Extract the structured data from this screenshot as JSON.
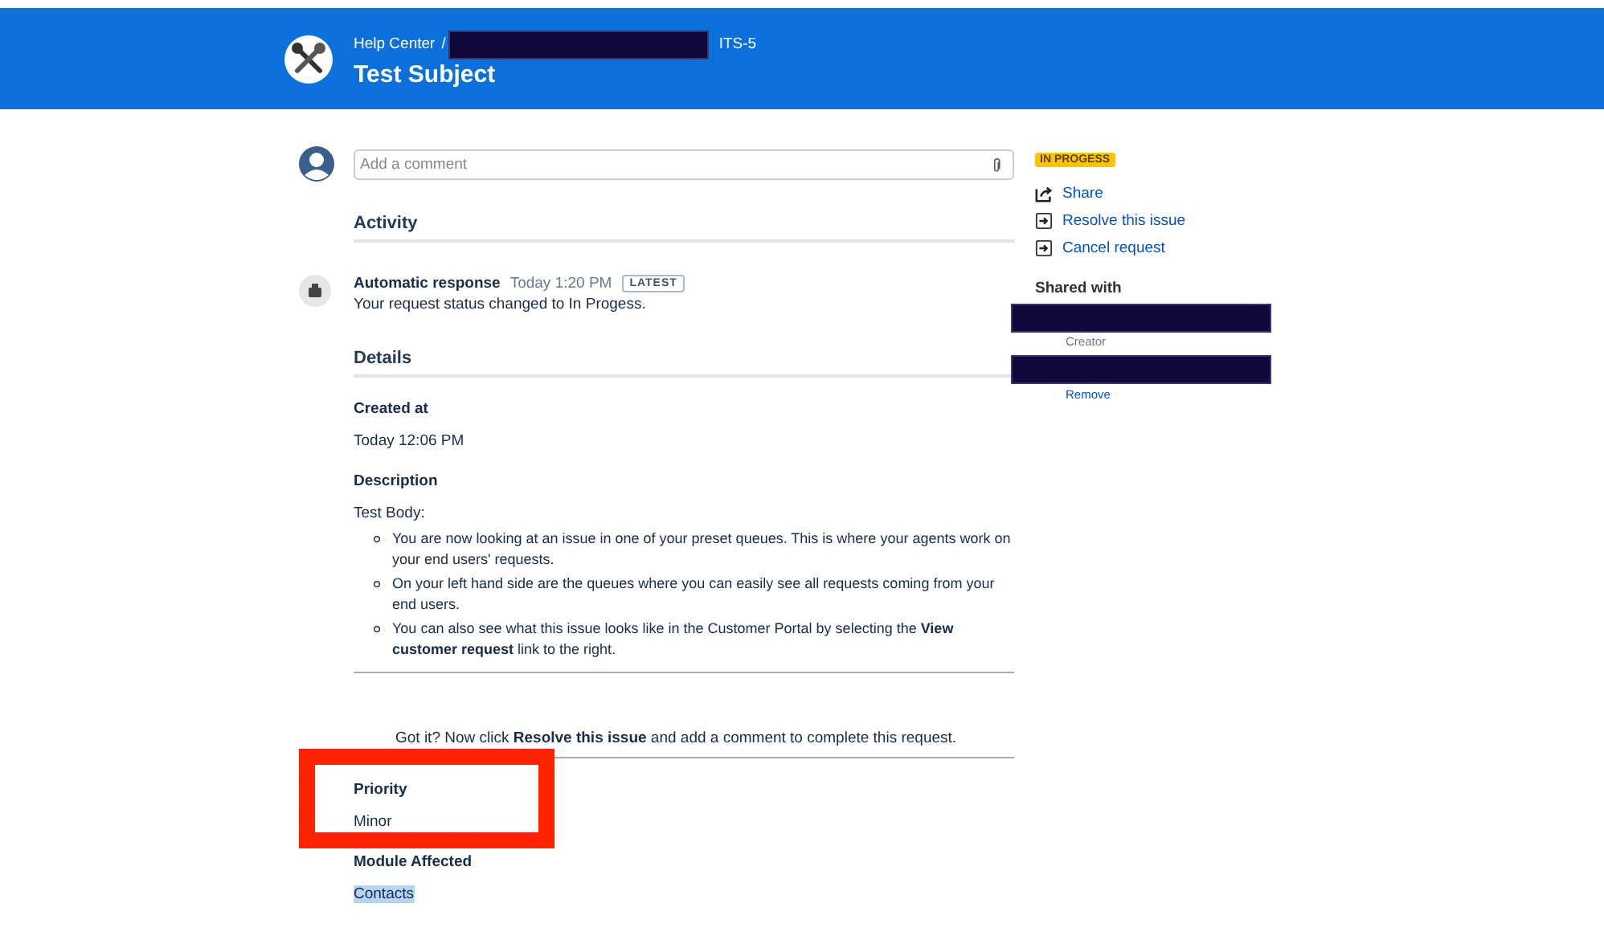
{
  "header": {
    "breadcrumb": "Help Center",
    "separator": "/",
    "redacted": true,
    "issue_key": "ITS-5",
    "title": "Test Subject"
  },
  "comment": {
    "placeholder": "Add a comment"
  },
  "activity": {
    "heading": "Activity",
    "entries": [
      {
        "author": "Automatic response",
        "time": "Today 1:20 PM",
        "badge": "LATEST",
        "message": "Your request status changed to In Progess."
      }
    ]
  },
  "details": {
    "heading": "Details",
    "fields": [
      {
        "kind": "text",
        "label": "Created at",
        "value": "Today 12:06 PM",
        "highlighted": false,
        "selected": false
      },
      {
        "kind": "description",
        "label": "Description",
        "intro": "Test Body:",
        "items": [
          "You are now looking at an issue in one of your preset queues. This is where your agents work on your end users' requests.",
          "On your left hand side are the queues where you can easily see all requests coming from your end users.",
          "You can also see what this issue looks like in the Customer Portal by selecting the  **View customer request** link to the right."
        ],
        "footer": "Got it? Now click  **Resolve this issue** and add a comment to complete this request."
      },
      {
        "kind": "text",
        "label": "Priority",
        "value": "Minor",
        "highlighted": true,
        "selected": false
      },
      {
        "kind": "text",
        "label": "Module Affected",
        "value": "Contacts",
        "highlighted": false,
        "selected": true
      }
    ]
  },
  "sidebar": {
    "status": "IN PROGESS",
    "actions": [
      {
        "kind": "share",
        "label": "Share"
      },
      {
        "kind": "transition",
        "label": "Resolve this issue"
      },
      {
        "kind": "transition",
        "label": "Cancel request"
      }
    ],
    "shared_with": {
      "heading": "Shared with",
      "people": [
        {
          "kind": "creator",
          "text": "Creator"
        },
        {
          "kind": "participant",
          "text": "Remove"
        }
      ]
    }
  }
}
